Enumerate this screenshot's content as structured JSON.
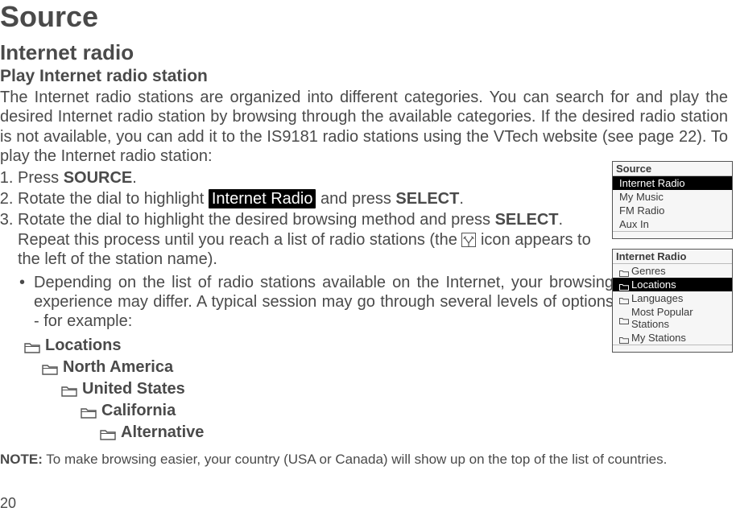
{
  "page_number": "20",
  "title": "Source",
  "subtitle": "Internet radio",
  "section": "Play Internet radio station",
  "intro": "The Internet radio stations are organized into different categories. You can search for and play the desired Internet radio station by browsing through the available categories. If the desired radio station is not available, you can add it to the IS9181 radio stations using the VTech website (see page 22). To play the Internet radio station:",
  "steps": {
    "s1_pre": "Press ",
    "s1_bold": "SOURCE",
    "s1_post": ".",
    "s2_pre": "Rotate the dial to highlight ",
    "s2_chip": "Internet Radio",
    "s2_mid": " and press ",
    "s2_bold": "SELECT",
    "s2_post": ".",
    "s3_pre": "Rotate the dial to highlight the desired browsing method and press ",
    "s3_bold": "SELECT",
    "s3_mid": ". Repeat this process until you reach a list of radio stations (the ",
    "s3_post": " icon appears to the left of the station name)."
  },
  "bullet": "Depending on the list of radio stations available on the Internet, your browsing experience may differ. A typical session may go through several levels of options - for example:",
  "tree": {
    "l1": "Locations",
    "l2": "North America",
    "l3": "United States",
    "l4": "California",
    "l5": "Alternative"
  },
  "note_label": "NOTE:",
  "note_text": " To make browsing easier, your country (USA or Canada) will show up on the top of the list of countries.",
  "screen1": {
    "title": "Source",
    "items": [
      "Internet Radio",
      "My Music",
      "FM Radio",
      "Aux In"
    ],
    "selected_index": 0
  },
  "screen2": {
    "title": "Internet Radio",
    "items": [
      "Genres",
      "Locations",
      "Languages",
      "Most Popular Stations",
      "My Stations"
    ],
    "selected_index": 1
  }
}
